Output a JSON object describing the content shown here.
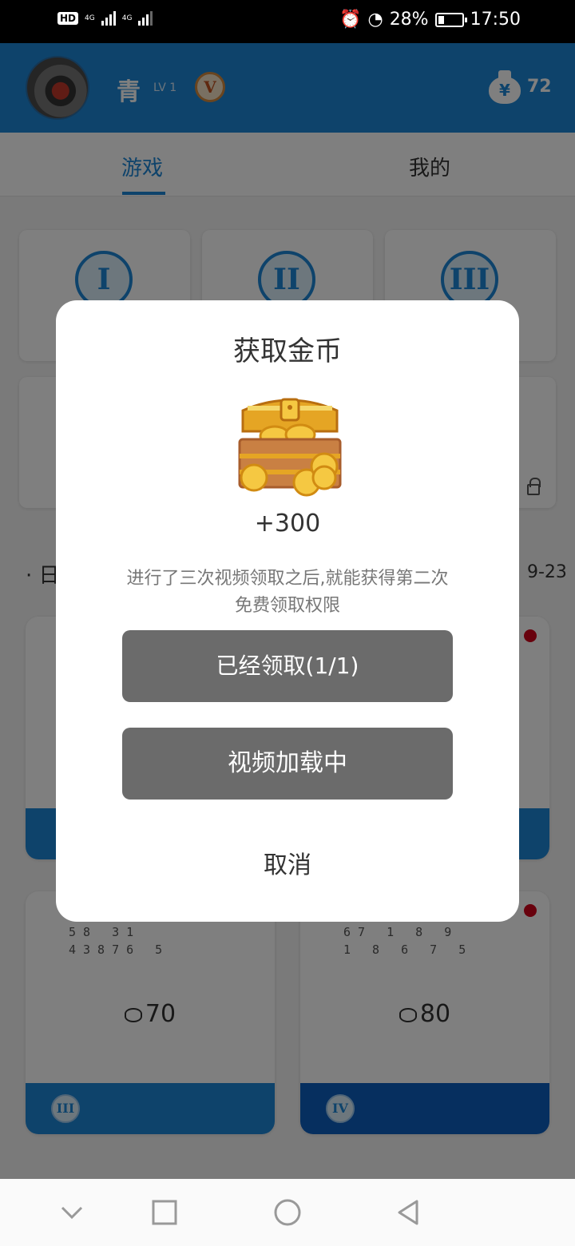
{
  "status_bar": {
    "hd": "HD",
    "network_1": "4G",
    "network_2": "4G",
    "battery_percent": "28%",
    "battery_level": 0.28,
    "time": "17:50"
  },
  "header": {
    "username": "青",
    "level": "LV 1",
    "vip_letter": "V",
    "coin_symbol": "¥",
    "coins": "72"
  },
  "tabs": [
    {
      "label": "游戏",
      "active": true
    },
    {
      "label": "我的",
      "active": false
    }
  ],
  "levels": [
    "I",
    "II",
    "III"
  ],
  "daily": {
    "label": "· 日",
    "date": "9-23"
  },
  "puzzles": [
    {
      "price": "70",
      "badge": "III",
      "grid": [
        "58  31   ",
        " 43876  5 "
      ]
    },
    {
      "price": "80",
      "badge": "IV",
      "grid": [
        "67 1 8 9 ",
        "1 8 6 7 5 "
      ]
    }
  ],
  "dialog": {
    "title": "获取金币",
    "reward": "+300",
    "hint": "进行了三次视频领取之后,就能获得第二次免费领取权限",
    "claimed_button": "已经领取(1/1)",
    "video_button": "视频加载中",
    "cancel": "取消"
  },
  "icons": {
    "accent": "#1c86d6",
    "coin_bag": "money-bag-icon",
    "chest": "treasure-chest-icon"
  }
}
